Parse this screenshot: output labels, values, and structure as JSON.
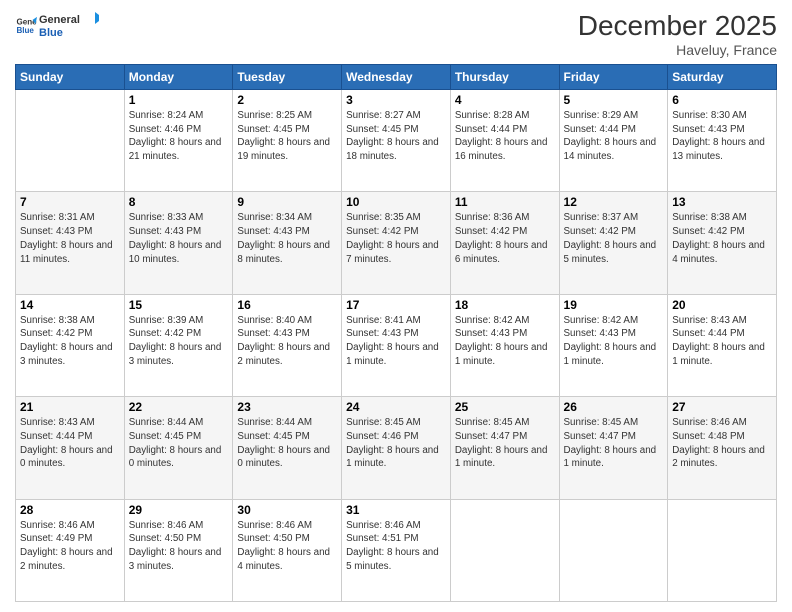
{
  "header": {
    "logo_line1": "General",
    "logo_line2": "Blue",
    "month_title": "December 2025",
    "location": "Haveluy, France"
  },
  "weekdays": [
    "Sunday",
    "Monday",
    "Tuesday",
    "Wednesday",
    "Thursday",
    "Friday",
    "Saturday"
  ],
  "weeks": [
    [
      {
        "date": "",
        "sunrise": "",
        "sunset": "",
        "daylight": ""
      },
      {
        "date": "1",
        "sunrise": "Sunrise: 8:24 AM",
        "sunset": "Sunset: 4:46 PM",
        "daylight": "Daylight: 8 hours and 21 minutes."
      },
      {
        "date": "2",
        "sunrise": "Sunrise: 8:25 AM",
        "sunset": "Sunset: 4:45 PM",
        "daylight": "Daylight: 8 hours and 19 minutes."
      },
      {
        "date": "3",
        "sunrise": "Sunrise: 8:27 AM",
        "sunset": "Sunset: 4:45 PM",
        "daylight": "Daylight: 8 hours and 18 minutes."
      },
      {
        "date": "4",
        "sunrise": "Sunrise: 8:28 AM",
        "sunset": "Sunset: 4:44 PM",
        "daylight": "Daylight: 8 hours and 16 minutes."
      },
      {
        "date": "5",
        "sunrise": "Sunrise: 8:29 AM",
        "sunset": "Sunset: 4:44 PM",
        "daylight": "Daylight: 8 hours and 14 minutes."
      },
      {
        "date": "6",
        "sunrise": "Sunrise: 8:30 AM",
        "sunset": "Sunset: 4:43 PM",
        "daylight": "Daylight: 8 hours and 13 minutes."
      }
    ],
    [
      {
        "date": "7",
        "sunrise": "Sunrise: 8:31 AM",
        "sunset": "Sunset: 4:43 PM",
        "daylight": "Daylight: 8 hours and 11 minutes."
      },
      {
        "date": "8",
        "sunrise": "Sunrise: 8:33 AM",
        "sunset": "Sunset: 4:43 PM",
        "daylight": "Daylight: 8 hours and 10 minutes."
      },
      {
        "date": "9",
        "sunrise": "Sunrise: 8:34 AM",
        "sunset": "Sunset: 4:43 PM",
        "daylight": "Daylight: 8 hours and 8 minutes."
      },
      {
        "date": "10",
        "sunrise": "Sunrise: 8:35 AM",
        "sunset": "Sunset: 4:42 PM",
        "daylight": "Daylight: 8 hours and 7 minutes."
      },
      {
        "date": "11",
        "sunrise": "Sunrise: 8:36 AM",
        "sunset": "Sunset: 4:42 PM",
        "daylight": "Daylight: 8 hours and 6 minutes."
      },
      {
        "date": "12",
        "sunrise": "Sunrise: 8:37 AM",
        "sunset": "Sunset: 4:42 PM",
        "daylight": "Daylight: 8 hours and 5 minutes."
      },
      {
        "date": "13",
        "sunrise": "Sunrise: 8:38 AM",
        "sunset": "Sunset: 4:42 PM",
        "daylight": "Daylight: 8 hours and 4 minutes."
      }
    ],
    [
      {
        "date": "14",
        "sunrise": "Sunrise: 8:38 AM",
        "sunset": "Sunset: 4:42 PM",
        "daylight": "Daylight: 8 hours and 3 minutes."
      },
      {
        "date": "15",
        "sunrise": "Sunrise: 8:39 AM",
        "sunset": "Sunset: 4:42 PM",
        "daylight": "Daylight: 8 hours and 3 minutes."
      },
      {
        "date": "16",
        "sunrise": "Sunrise: 8:40 AM",
        "sunset": "Sunset: 4:43 PM",
        "daylight": "Daylight: 8 hours and 2 minutes."
      },
      {
        "date": "17",
        "sunrise": "Sunrise: 8:41 AM",
        "sunset": "Sunset: 4:43 PM",
        "daylight": "Daylight: 8 hours and 1 minute."
      },
      {
        "date": "18",
        "sunrise": "Sunrise: 8:42 AM",
        "sunset": "Sunset: 4:43 PM",
        "daylight": "Daylight: 8 hours and 1 minute."
      },
      {
        "date": "19",
        "sunrise": "Sunrise: 8:42 AM",
        "sunset": "Sunset: 4:43 PM",
        "daylight": "Daylight: 8 hours and 1 minute."
      },
      {
        "date": "20",
        "sunrise": "Sunrise: 8:43 AM",
        "sunset": "Sunset: 4:44 PM",
        "daylight": "Daylight: 8 hours and 1 minute."
      }
    ],
    [
      {
        "date": "21",
        "sunrise": "Sunrise: 8:43 AM",
        "sunset": "Sunset: 4:44 PM",
        "daylight": "Daylight: 8 hours and 0 minutes."
      },
      {
        "date": "22",
        "sunrise": "Sunrise: 8:44 AM",
        "sunset": "Sunset: 4:45 PM",
        "daylight": "Daylight: 8 hours and 0 minutes."
      },
      {
        "date": "23",
        "sunrise": "Sunrise: 8:44 AM",
        "sunset": "Sunset: 4:45 PM",
        "daylight": "Daylight: 8 hours and 0 minutes."
      },
      {
        "date": "24",
        "sunrise": "Sunrise: 8:45 AM",
        "sunset": "Sunset: 4:46 PM",
        "daylight": "Daylight: 8 hours and 1 minute."
      },
      {
        "date": "25",
        "sunrise": "Sunrise: 8:45 AM",
        "sunset": "Sunset: 4:47 PM",
        "daylight": "Daylight: 8 hours and 1 minute."
      },
      {
        "date": "26",
        "sunrise": "Sunrise: 8:45 AM",
        "sunset": "Sunset: 4:47 PM",
        "daylight": "Daylight: 8 hours and 1 minute."
      },
      {
        "date": "27",
        "sunrise": "Sunrise: 8:46 AM",
        "sunset": "Sunset: 4:48 PM",
        "daylight": "Daylight: 8 hours and 2 minutes."
      }
    ],
    [
      {
        "date": "28",
        "sunrise": "Sunrise: 8:46 AM",
        "sunset": "Sunset: 4:49 PM",
        "daylight": "Daylight: 8 hours and 2 minutes."
      },
      {
        "date": "29",
        "sunrise": "Sunrise: 8:46 AM",
        "sunset": "Sunset: 4:50 PM",
        "daylight": "Daylight: 8 hours and 3 minutes."
      },
      {
        "date": "30",
        "sunrise": "Sunrise: 8:46 AM",
        "sunset": "Sunset: 4:50 PM",
        "daylight": "Daylight: 8 hours and 4 minutes."
      },
      {
        "date": "31",
        "sunrise": "Sunrise: 8:46 AM",
        "sunset": "Sunset: 4:51 PM",
        "daylight": "Daylight: 8 hours and 5 minutes."
      },
      {
        "date": "",
        "sunrise": "",
        "sunset": "",
        "daylight": ""
      },
      {
        "date": "",
        "sunrise": "",
        "sunset": "",
        "daylight": ""
      },
      {
        "date": "",
        "sunrise": "",
        "sunset": "",
        "daylight": ""
      }
    ]
  ]
}
